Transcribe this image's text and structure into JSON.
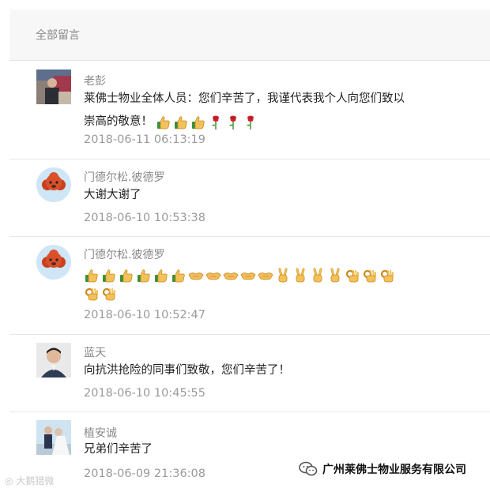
{
  "header": {
    "title": "全部留言"
  },
  "comments": [
    {
      "author": "老彭",
      "lines": [
        "莱佛士物业全体人员：您们辛苦了，我谨代表我个人向您们致以",
        "崇高的敬意！"
      ],
      "emoji_icons": [
        "thumbs-up-icon",
        "thumbs-up-icon",
        "thumbs-up-icon",
        "rose-icon",
        "rose-icon",
        "rose-icon"
      ],
      "time": "2018-06-11 06:13:19"
    },
    {
      "author": "门德尔松.彼德罗",
      "lines": [
        "大谢大谢了"
      ],
      "time": "2018-06-10 10:53:38"
    },
    {
      "author": "门德尔松.彼德罗",
      "emoji_row1": [
        "thumbs-up-icon",
        "thumbs-up-icon",
        "thumbs-up-icon",
        "thumbs-up-icon",
        "thumbs-up-icon",
        "thumbs-up-icon",
        "handshake-icon",
        "handshake-icon",
        "handshake-icon",
        "handshake-icon",
        "handshake-icon",
        "victory-icon",
        "victory-icon",
        "victory-icon",
        "victory-icon",
        "ok-hand-icon",
        "ok-hand-icon",
        "ok-hand-icon"
      ],
      "emoji_row2": [
        "ok-hand-icon",
        "ok-hand-icon"
      ],
      "time": "2018-06-10 10:52:47"
    },
    {
      "author": "蓝天",
      "lines": [
        "向抗洪抢险的同事们致敬，您们辛苦了！"
      ],
      "time": "2018-06-10 10:45:55"
    },
    {
      "author": "植安诚",
      "lines": [
        "兄弟们辛苦了"
      ],
      "time": "2018-06-09 21:36:08"
    }
  ],
  "watermark": "大鹅猎微",
  "brand": {
    "name": "广州莱佛士物业服务有限公司",
    "icon": "wechat-icon"
  }
}
